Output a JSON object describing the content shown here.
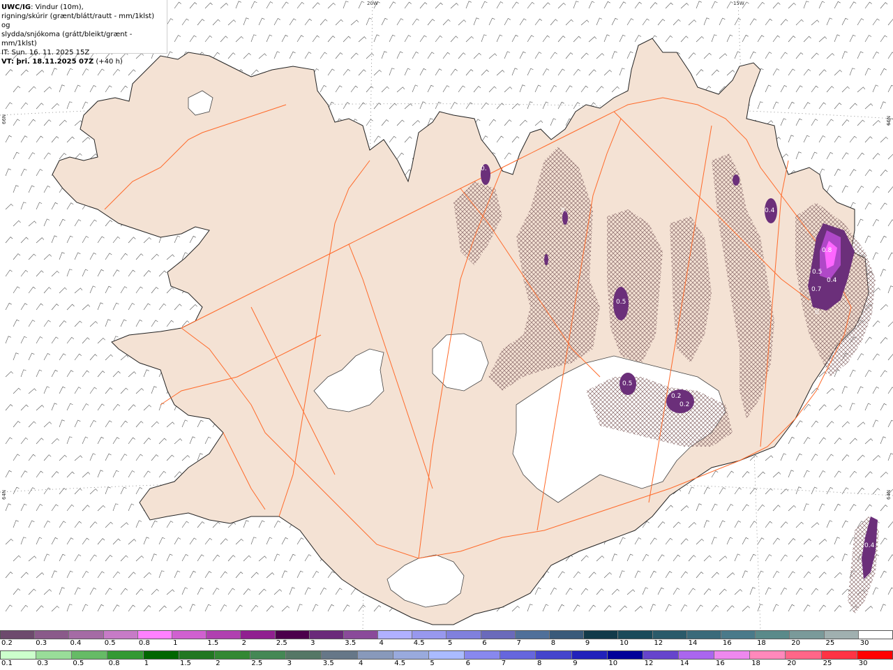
{
  "header": {
    "title": "UWC/IG",
    "description_line1": ": Vindur (10m),",
    "description_line2": "rigning/skúrir (grænt/blátt/rautt - mm/1klst) og",
    "description_line3": "slydda/snjókoma (grátt/bleikt/grænt - mm/1klst)",
    "init_time": "IT: Sun. 16. 11. 2025 15Z",
    "valid_label": "VT: þri. 18.11.2025 07Z",
    "valid_suffix": " (+40 h)"
  },
  "grid_labels": {
    "lon_20w": "20W",
    "lon_15w": "15W",
    "lat_66n_left": "66N",
    "lat_66n_right": "66N",
    "lat_64n_left": "64N",
    "lat_64n_right": "64N"
  },
  "precip_labels": {
    "westfjords_north": "0.",
    "eyjafjordur": "0.",
    "hofsjokull_east": "0.5",
    "vatnajokull_nw": "0.5",
    "vatnajokull_c1": "0.2",
    "vatnajokull_c2": "0.2",
    "northeast": "0.4",
    "eastfjords_1": "0.8",
    "eastfjords_2": "0.5",
    "eastfjords_3": "0.4",
    "eastfjords_4": "0.7",
    "eastfjords_5": "0.",
    "offshore_se": "0.4"
  },
  "snow_scale": {
    "labels": [
      "0.2",
      "0.3",
      "0.4",
      "0.5",
      "0.8",
      "1",
      "1.5",
      "2",
      "2.5",
      "3",
      "3.5",
      "4",
      "4.5",
      "5",
      "6",
      "7",
      "8",
      "9",
      "10",
      "12",
      "14",
      "16",
      "18",
      "20",
      "25",
      "30"
    ],
    "colors": [
      "#6d4a6d",
      "#8a5a8a",
      "#a56ba5",
      "#c77bc7",
      "#ff80ff",
      "#d060d0",
      "#b040b0",
      "#902090",
      "#4b004b",
      "#6a2a7a",
      "#8a4a9a",
      "#b0b0ff",
      "#9898ee",
      "#8080dd",
      "#6a6abb",
      "#50709a",
      "#3a5a7a",
      "#123a4a",
      "#1a4a5a",
      "#2a5a6a",
      "#3a6a7a",
      "#4a7a8a",
      "#5a8a8a",
      "#7a9a9a",
      "#a0b0b0",
      "#ffffff"
    ]
  },
  "rain_scale": {
    "labels": [
      "0.1",
      "0.3",
      "0.5",
      "0.8",
      "1",
      "1.5",
      "2",
      "2.5",
      "3",
      "3.5",
      "4",
      "4.5",
      "5",
      "6",
      "7",
      "8",
      "9",
      "10",
      "12",
      "14",
      "16",
      "18",
      "20",
      "25",
      "30"
    ],
    "colors": [
      "#ccffcc",
      "#99dd99",
      "#66bb66",
      "#339933",
      "#006600",
      "#227722",
      "#338833",
      "#448855",
      "#557766",
      "#667788",
      "#8899bb",
      "#99aadd",
      "#aabbff",
      "#8888ee",
      "#6666dd",
      "#4444cc",
      "#2222bb",
      "#000099",
      "#6644cc",
      "#aa66ee",
      "#ee88ee",
      "#ff88bb",
      "#ff6688",
      "#ff3344",
      "#ff0000"
    ]
  },
  "colors": {
    "land": "#f4e2d4",
    "roads": "#ff6a2a",
    "coast": "#222222",
    "snow_hatch": "#8a6a6a",
    "precip_dark": "#6b2f7a",
    "precip_mid": "#9b3fbf",
    "precip_light": "#ff66ff"
  }
}
